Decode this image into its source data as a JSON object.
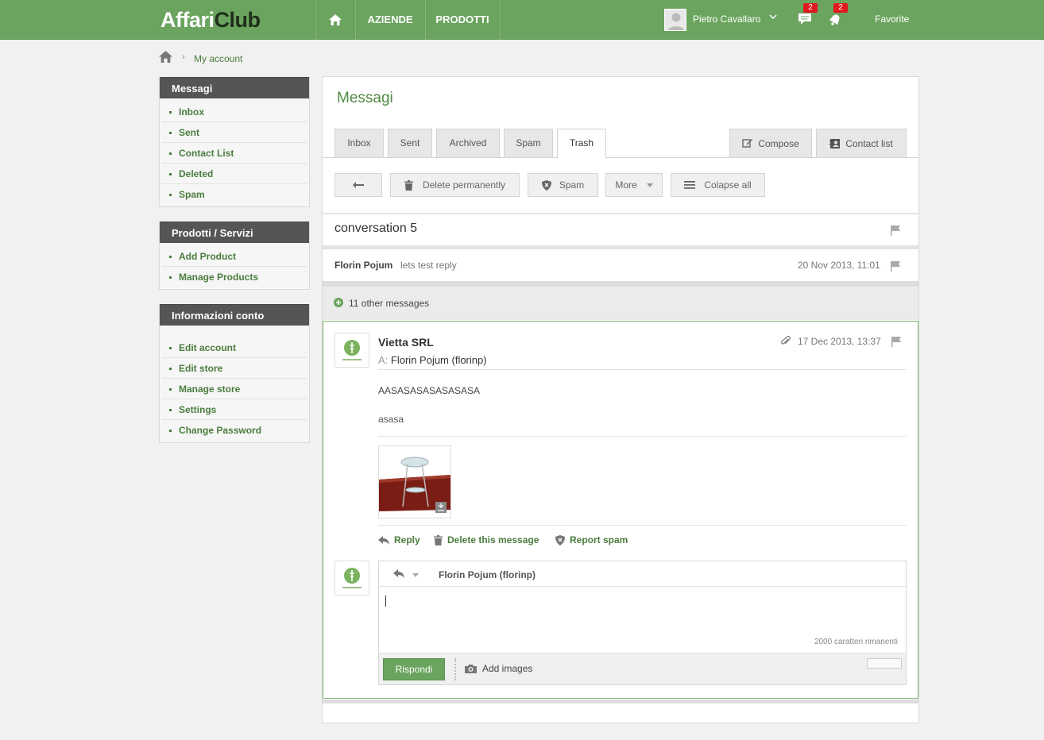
{
  "topbar": {
    "logo_main": "Affari",
    "logo_accent": "Club",
    "nav": [
      "AZIENDE",
      "PRODOTTI"
    ],
    "user_name": "Pietro Cavallaro",
    "messages_badge": "2",
    "notifications_badge": "2",
    "favorite_label": "Favorite"
  },
  "breadcrumb": {
    "link": "My account"
  },
  "sidebar": {
    "messagi": {
      "title": "Messagi",
      "items": [
        "Inbox",
        "Sent",
        "Contact List",
        "Deleted",
        "Spam"
      ]
    },
    "prodotti": {
      "title": "Prodotti / Servizi",
      "items": [
        "Add Product",
        "Manage Products"
      ]
    },
    "conto": {
      "title": "Informazioni conto",
      "items": [
        "Edit account",
        "Edit store",
        "Manage store",
        "Settings",
        "Change Password"
      ]
    }
  },
  "main": {
    "title": "Messagi",
    "tabs": [
      "Inbox",
      "Sent",
      "Archived",
      "Spam",
      "Trash"
    ],
    "active_tab": "Trash",
    "compose_label": "Compose",
    "contact_list_label": "Contact list",
    "toolbar": {
      "delete_label": "Delete permanently",
      "spam_label": "Spam",
      "more_label": "More",
      "collapse_label": "Colapse all"
    },
    "conversation_title": "conversation 5",
    "summary": {
      "from": "Florin Pojum",
      "snippet": "lets test reply",
      "date": "20 Nov 2013, 11:01"
    },
    "others_label": "11 other messages",
    "message": {
      "sender": "Vietta SRL",
      "to_label": "A:",
      "to": "Florin Pojum (florinp)",
      "date": "17 Dec 2013, 13:37",
      "body_line1": "AASASASASASASASA",
      "body_line2": "asasa",
      "reply_label": "Reply",
      "delete_label": "Delete this message",
      "report_label": "Report spam"
    },
    "reply_box": {
      "to": "Florin Pojum (florinp)",
      "counter": "2000 caratteri rimanenti",
      "submit_label": "Rispondi",
      "add_images_label": "Add images"
    }
  },
  "colors": {
    "brand_green": "#6aa45e",
    "link_green": "#4a7c3e",
    "badge_red": "#e0191f",
    "sidebar_header": "#555555"
  }
}
